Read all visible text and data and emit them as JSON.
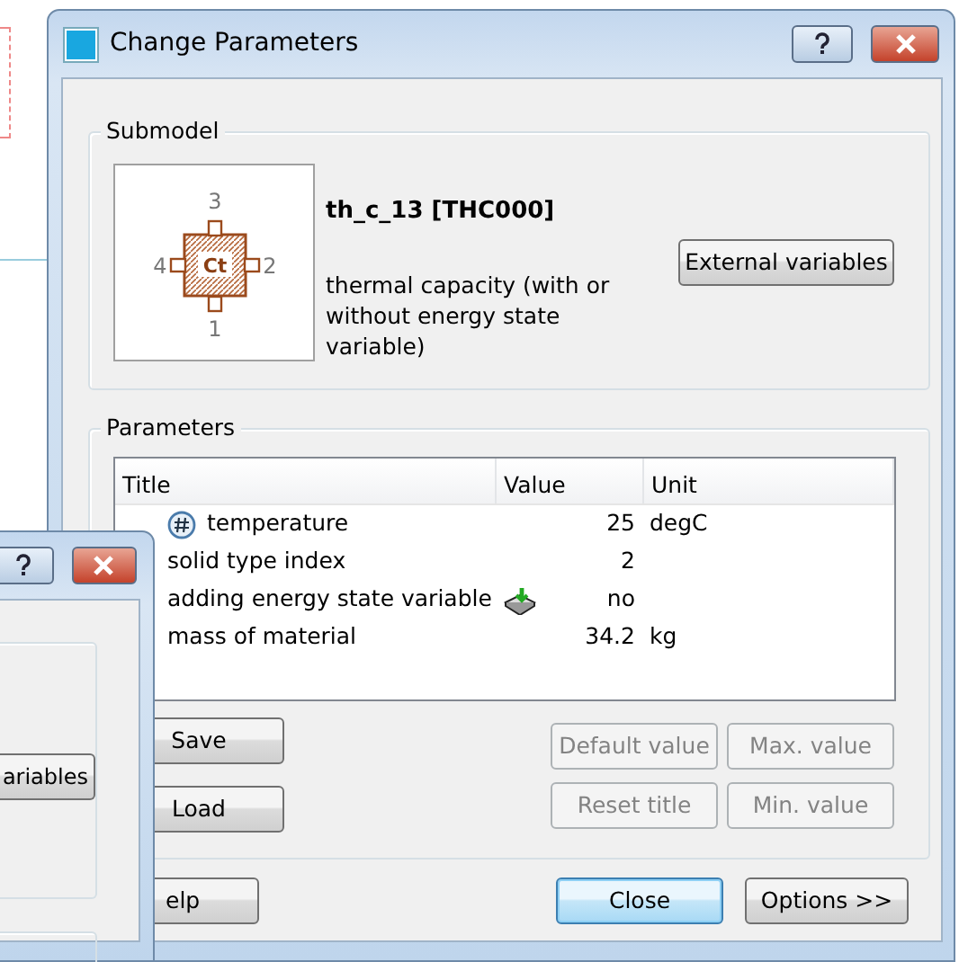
{
  "window": {
    "title": "Change Parameters"
  },
  "submodel": {
    "legend": "Submodel",
    "diagram": {
      "symbol": "Ct",
      "ports": [
        "3",
        "4",
        "2",
        "1"
      ]
    },
    "name": "th_c_13 [THC000]",
    "description": "thermal capacity (with or without energy state variable)",
    "button": "External variables"
  },
  "parameters": {
    "legend": "Parameters",
    "columns": [
      "Title",
      "Value",
      "Unit"
    ],
    "rows": [
      {
        "kind": "global",
        "title": "temperature",
        "value": "25",
        "unit": "degC"
      },
      {
        "kind": "plain",
        "title": "solid type index",
        "value": "2"
      },
      {
        "kind": "choice",
        "title": "adding energy state variable",
        "value": "no"
      },
      {
        "kind": "plain",
        "title": "mass of material",
        "value": "34.2",
        "unit": "kg"
      }
    ],
    "file_buttons": [
      "Save",
      "Load"
    ],
    "buttons": [
      {
        "label": "Default value",
        "disabled": true
      },
      {
        "label": "Max. value",
        "disabled": true
      },
      {
        "label": "Reset title",
        "disabled": true
      },
      {
        "label": "Min. value",
        "disabled": true
      }
    ]
  },
  "footer": [
    {
      "label": "elp",
      "default": false
    },
    {
      "label": "Close",
      "default": true
    },
    {
      "label": "Options >>",
      "default": false
    }
  ],
  "background_window": {
    "button": "ariables"
  }
}
